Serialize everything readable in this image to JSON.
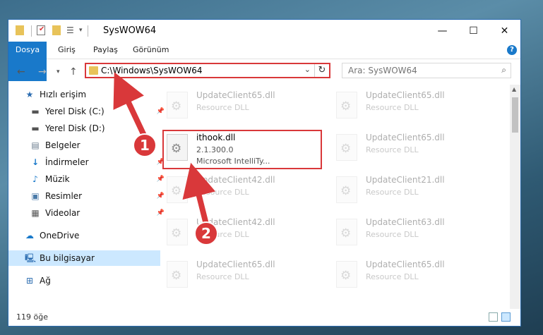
{
  "window": {
    "title": "SysWOW64"
  },
  "ribbon": {
    "tabs": [
      {
        "label": "Dosya"
      },
      {
        "label": "Giriş"
      },
      {
        "label": "Paylaş"
      },
      {
        "label": "Görünüm"
      }
    ],
    "help": "?"
  },
  "address": {
    "path": "C:\\Windows\\SysWOW64"
  },
  "search": {
    "placeholder": "Ara: SysWOW64"
  },
  "sidebar": {
    "items": [
      {
        "label": "Hızlı erişim",
        "icon": "star-icon"
      },
      {
        "label": "Yerel Disk (C:)",
        "icon": "drive-icon"
      },
      {
        "label": "Yerel Disk (D:)",
        "icon": "drive-icon"
      },
      {
        "label": "Belgeler",
        "icon": "documents-icon"
      },
      {
        "label": "İndirmeler",
        "icon": "download-icon"
      },
      {
        "label": "Müzik",
        "icon": "music-icon"
      },
      {
        "label": "Resimler",
        "icon": "pictures-icon"
      },
      {
        "label": "Videolar",
        "icon": "videos-icon"
      },
      {
        "label": "OneDrive",
        "icon": "cloud-icon"
      },
      {
        "label": "Bu bilgisayar",
        "icon": "computer-icon"
      },
      {
        "label": "Ağ",
        "icon": "network-icon"
      }
    ]
  },
  "files": {
    "left": [
      {
        "name": "UpdateClient65.dll",
        "type": "Resource DLL"
      },
      {
        "name": "ithook.dll",
        "version": "2.1.300.0",
        "type": "Microsoft IntelliTy..."
      },
      {
        "name": "UpdateClient42.dll",
        "type": "Resource DLL"
      },
      {
        "name": "UpdateClient42.dll",
        "type": "Resource DLL"
      },
      {
        "name": "UpdateClient65.dll",
        "type": "Resource DLL"
      }
    ],
    "right": [
      {
        "name": "UpdateClient65.dll",
        "type": "Resource DLL"
      },
      {
        "name": "UpdateClient65.dll",
        "type": "Resource DLL"
      },
      {
        "name": "UpdateClient21.dll",
        "type": "Resource DLL"
      },
      {
        "name": "UpdateClient63.dll",
        "type": "Resource DLL"
      },
      {
        "name": "UpdateClient65.dll",
        "type": "Resource DLL"
      }
    ]
  },
  "status": {
    "count": "119 öğe"
  },
  "annotations": {
    "step1": "1",
    "step2": "2"
  },
  "colors": {
    "accent": "#1979ca",
    "highlight": "#d9383a",
    "selected": "#cce8ff"
  }
}
